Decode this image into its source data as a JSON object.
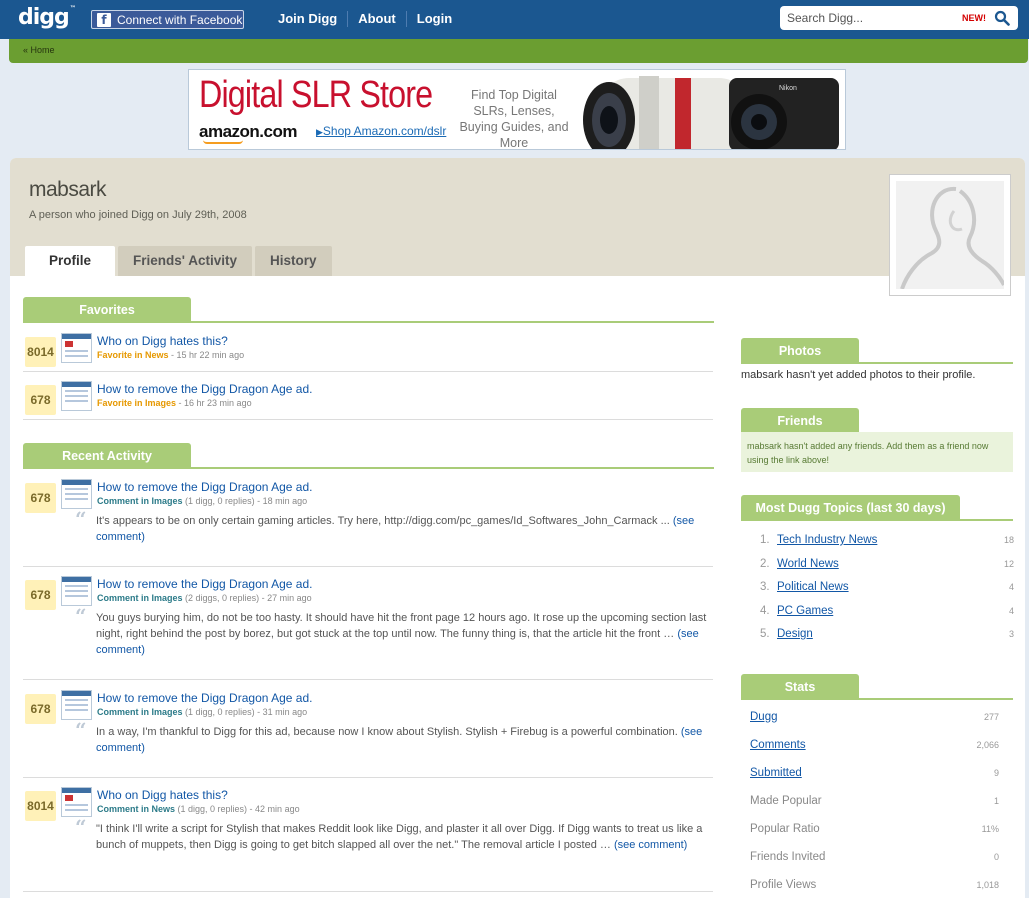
{
  "header": {
    "logo": "digg",
    "logo_tm": "™",
    "facebook_button": "Connect with Facebook",
    "nav": [
      "Join Digg",
      "About",
      "Login"
    ],
    "search_placeholder": "Search Digg...",
    "search_badge": "NEW!"
  },
  "breadcrumb": "« Home",
  "ad": {
    "title": "Digital SLR Store",
    "brand": "amazon.com",
    "shop_link": "Shop Amazon.com/dslr",
    "tagline": "Find Top Digital SLRs, Lenses, Buying Guides, and More",
    "camera_brand": "Nikon"
  },
  "profile": {
    "username": "mabsark",
    "joined": "A person who joined Digg on July 29th, 2008",
    "tabs": [
      "Profile",
      "Friends' Activity",
      "History"
    ]
  },
  "favorites": {
    "heading": "Favorites",
    "items": [
      {
        "score": "8014",
        "title": "Who on Digg hates this?",
        "label": "Favorite in News",
        "time": " - 15 hr 22 min ago"
      },
      {
        "score": "678",
        "title": "How to remove the Digg Dragon Age ad.",
        "label": "Favorite in Images",
        "time": " - 16 hr 23 min ago"
      }
    ]
  },
  "recent": {
    "heading": "Recent Activity",
    "see_comment": "(see comment)",
    "items": [
      {
        "score": "678",
        "title": "How to remove the Digg Dragon Age ad.",
        "label": "Comment in Images",
        "meta": " (1 digg, 0 replies) - 18 min ago",
        "quote": "It's appears to be on only certain gaming articles. Try here, http://digg.com/pc_games/Id_Softwares_John_Carmack ... "
      },
      {
        "score": "678",
        "title": "How to remove the Digg Dragon Age ad.",
        "label": "Comment in Images",
        "meta": " (2 diggs, 0 replies) - 27 min ago",
        "quote": "You guys burying him, do not be too hasty. It should have hit the front page 12 hours ago. It rose up the upcoming section last night, right behind the post by borez, but got stuck at the top until now. The funny thing is, that the article hit the front … "
      },
      {
        "score": "678",
        "title": "How to remove the Digg Dragon Age ad.",
        "label": "Comment in Images",
        "meta": " (1 digg, 0 replies) - 31 min ago",
        "quote": "In a way, I'm thankful to Digg for this ad, because now I know about Stylish. Stylish + Firebug is a powerful combination. "
      },
      {
        "score": "8014",
        "title": "Who on Digg hates this?",
        "label": "Comment in News",
        "meta": " (1 digg, 0 replies) - 42 min ago",
        "quote": "\"I think I'll write a script for Stylish that makes Reddit look like Digg, and plaster it all over Digg. If Digg wants to treat us like a bunch of muppets, then Digg is going to get bitch slapped all over the net.\" The removal article I posted … "
      }
    ]
  },
  "sidebar": {
    "photos_heading": "Photos",
    "photos_text": "mabsark hasn't yet added photos to their profile.",
    "friends_heading": "Friends",
    "friends_text": "mabsark hasn't added any friends. Add them as a friend now using the link above!",
    "topics_heading": "Most Dugg Topics (last 30 days)",
    "topics": [
      {
        "num": "1.",
        "name": "Tech Industry News",
        "count": "18"
      },
      {
        "num": "2.",
        "name": "World News",
        "count": "12"
      },
      {
        "num": "3.",
        "name": "Political News",
        "count": "4"
      },
      {
        "num": "4.",
        "name": "PC Games",
        "count": "4"
      },
      {
        "num": "5.",
        "name": "Design",
        "count": "3"
      }
    ],
    "stats_heading": "Stats",
    "stats": [
      {
        "name": "Dugg",
        "value": "277",
        "link": true
      },
      {
        "name": "Comments",
        "value": "2,066",
        "link": true
      },
      {
        "name": "Submitted",
        "value": "9",
        "link": true
      },
      {
        "name": "Made Popular",
        "value": "1",
        "link": false
      },
      {
        "name": "Popular Ratio",
        "value": "11%",
        "link": false
      },
      {
        "name": "Friends Invited",
        "value": "0",
        "link": false
      },
      {
        "name": "Profile Views",
        "value": "1,018",
        "link": false
      }
    ]
  },
  "colors": {
    "header_blue": "#1b5790",
    "green_bar": "#6b9e31",
    "section_green": "#a9cc78",
    "link_blue": "#1257a6",
    "score_yellow": "#fff1b8"
  }
}
